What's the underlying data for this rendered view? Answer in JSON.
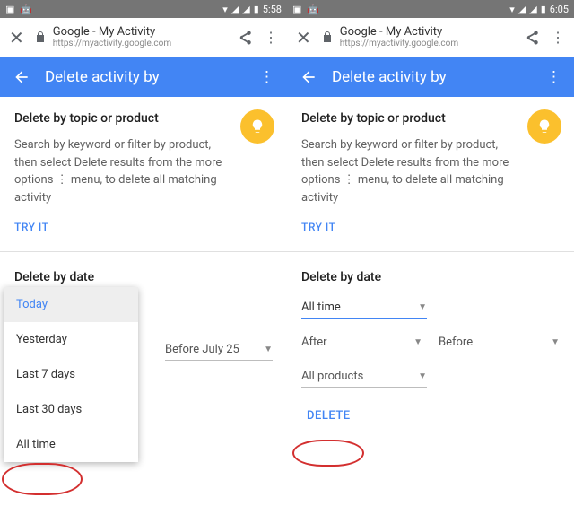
{
  "phones": [
    {
      "status": {
        "time": "5:58"
      },
      "url": {
        "title": "Google - My Activity",
        "sub": "https://myactivity.google.com"
      },
      "appbar": {
        "title": "Delete activity by"
      },
      "section1": {
        "title": "Delete by topic or product",
        "desc": "Search by keyword or filter by product, then select Delete results from the more options  ⋮  menu, to delete all matching activity",
        "tryit": "TRY IT"
      },
      "section2": {
        "title": "Delete by date"
      },
      "popup": {
        "items": [
          "Today",
          "Yesterday",
          "Last 7 days",
          "Last 30 days",
          "All time"
        ],
        "selected_index": 0
      },
      "before_select": {
        "label": "Before July 25"
      },
      "highlight": "All time"
    },
    {
      "status": {
        "time": "6:05"
      },
      "url": {
        "title": "Google - My Activity",
        "sub": "https://myactivity.google.com"
      },
      "appbar": {
        "title": "Delete activity by"
      },
      "section1": {
        "title": "Delete by topic or product",
        "desc": "Search by keyword or filter by product, then select Delete results from the more options  ⋮  menu, to delete all matching activity",
        "tryit": "TRY IT"
      },
      "section2": {
        "title": "Delete by date"
      },
      "range_select": {
        "value": "All time"
      },
      "after_select": {
        "label": "After"
      },
      "before_select": {
        "label": "Before"
      },
      "products_select": {
        "value": "All products"
      },
      "delete_button": "DELETE",
      "highlight": "DELETE"
    }
  ]
}
